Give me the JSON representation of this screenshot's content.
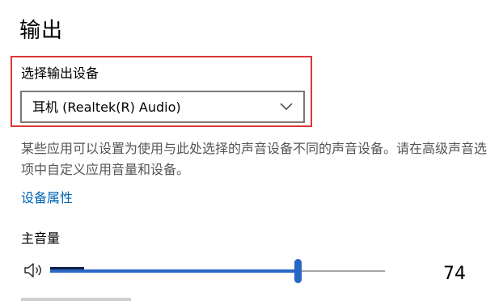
{
  "output": {
    "title": "输出",
    "select_label": "选择输出设备",
    "device_dropdown": {
      "selected": "耳机 (Realtek(R) Audio)",
      "icon": "chevron-down-icon"
    },
    "description": "某些应用可以设置为使用与此处选择的声音设备不同的声音设备。请在高级声音选项中自定义应用音量和设备。",
    "device_properties_link": "设备属性",
    "master_volume": {
      "label": "主音量",
      "value": "74",
      "level": 0.74,
      "icon": "speaker-icon"
    }
  },
  "colors": {
    "highlight": "#d9383a",
    "accent": "#2a66c4",
    "link": "#0063b1",
    "description_text": "#555555"
  }
}
